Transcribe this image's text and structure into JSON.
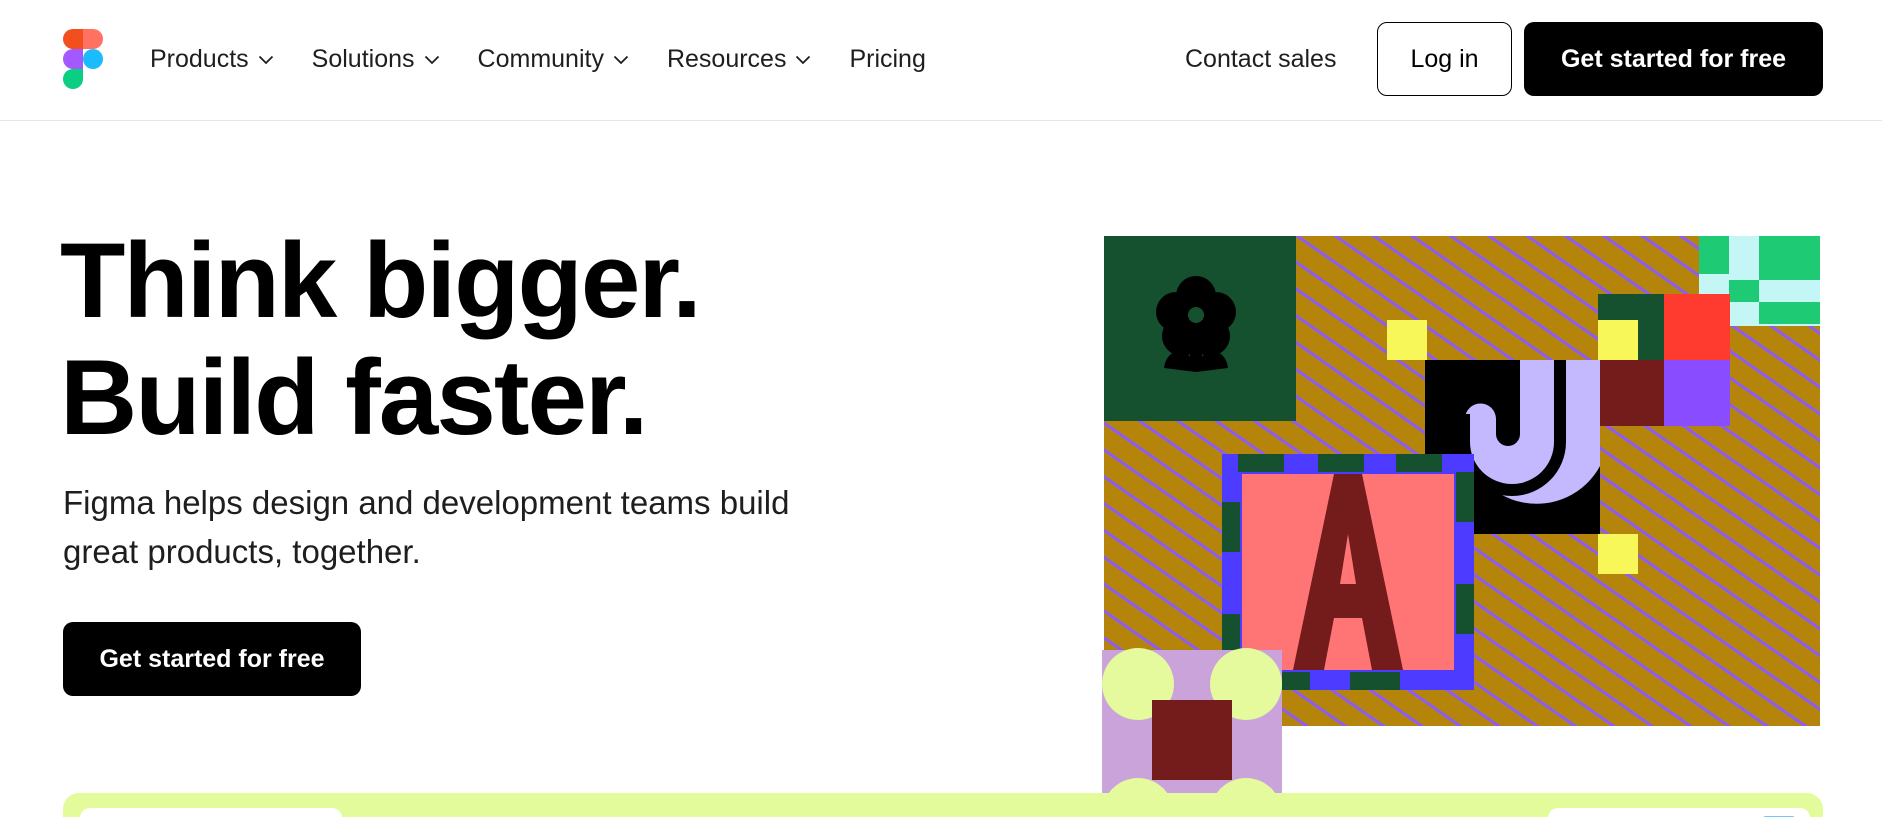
{
  "brand": {
    "name": "Figma",
    "logo_icon": "figma-logo-icon"
  },
  "nav": {
    "items": [
      {
        "label": "Products",
        "has_menu": true
      },
      {
        "label": "Solutions",
        "has_menu": true
      },
      {
        "label": "Community",
        "has_menu": true
      },
      {
        "label": "Resources",
        "has_menu": true
      },
      {
        "label": "Pricing",
        "has_menu": false
      }
    ],
    "contact_sales": "Contact sales",
    "login": "Log in",
    "cta": "Get started for free"
  },
  "hero": {
    "headline_line1": "Think bigger.",
    "headline_line2": "Build faster.",
    "subtext": "Figma helps design and development teams build great products, together.",
    "cta": "Get started for free"
  },
  "colors": {
    "black": "#000000",
    "cta_text": "#ffffff",
    "strip_green": "#e3fb9b",
    "art_mustard": "#b5850b",
    "art_stripe": "#8b5cf6",
    "art_dark_green": "#15512f",
    "art_coral": "#ff7475",
    "art_maroon": "#741b1b",
    "art_lavender": "#c4b9ff",
    "art_blue": "#4d3bff",
    "art_yellow": "#f8f75a",
    "art_red": "#ff3b2f",
    "art_purple": "#8a4cff",
    "art_mint": "#1ecb74",
    "art_pale_cyan": "#c4f6f6",
    "art_lime": "#e4fa9c",
    "art_pink_lilac": "#c9a3d9"
  }
}
